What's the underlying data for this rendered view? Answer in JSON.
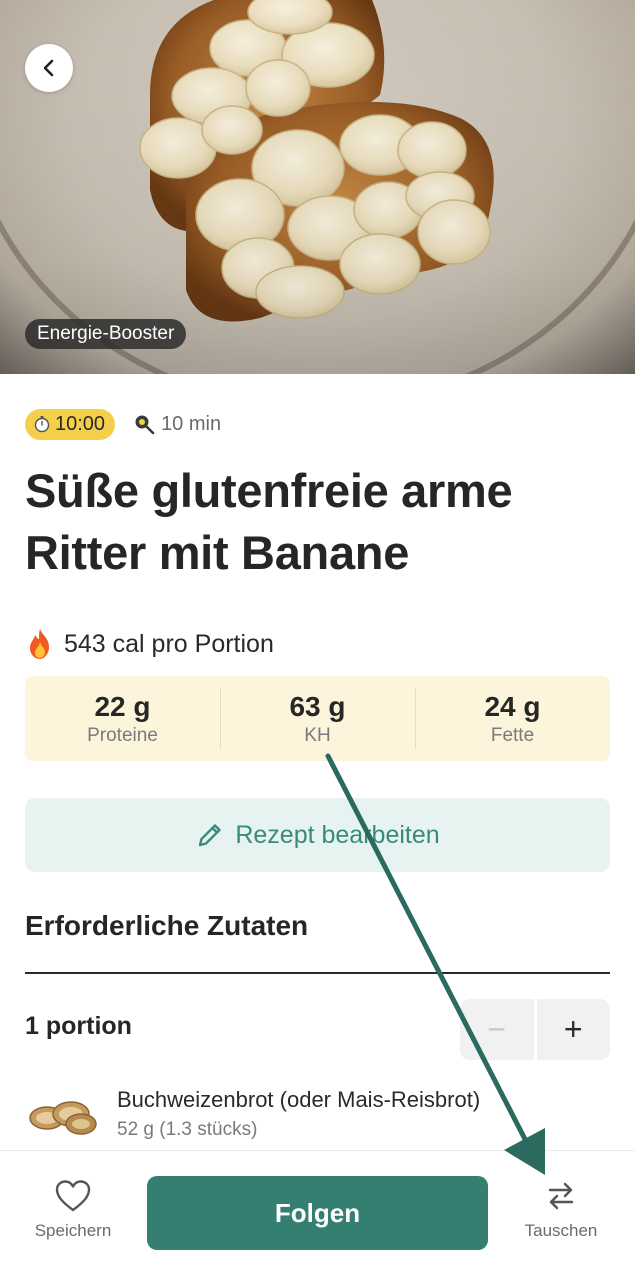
{
  "hero": {
    "tag": "Energie-Booster"
  },
  "meta": {
    "time": "10:00",
    "prep": "10 min"
  },
  "recipe": {
    "title_line1": "Süße glutenfreie arme",
    "title_line2": "Ritter mit Banane",
    "calories": "543 cal pro Portion"
  },
  "macros": [
    {
      "value": "22 g",
      "label": "Proteine"
    },
    {
      "value": "63 g",
      "label": "KH"
    },
    {
      "value": "24 g",
      "label": "Fette"
    }
  ],
  "edit_label": "Rezept bearbeiten",
  "ingredients_section": {
    "title": "Erforderliche Zutaten",
    "portion": "1 portion",
    "minus": "−",
    "plus": "+",
    "items": [
      {
        "name": "Buchweizenbrot (oder Mais-Reisbrot)",
        "qty": "52 g (1.3 stücks)"
      }
    ]
  },
  "bottom": {
    "save": "Speichern",
    "follow": "Folgen",
    "swap": "Tauschen"
  },
  "colors": {
    "accent": "#357f72",
    "time_badge": "#f4cf4a",
    "macro_bg": "#fdf4dc",
    "edit_bg": "#e6f3f1",
    "arrow": "#2b6b5f"
  },
  "icons": {
    "back": "chevron-left-icon",
    "time": "stopwatch-icon",
    "prep": "frying-pan-icon",
    "calories": "fire-icon",
    "edit": "pencil-icon",
    "save": "heart-icon",
    "swap": "swap-arrows-icon"
  }
}
